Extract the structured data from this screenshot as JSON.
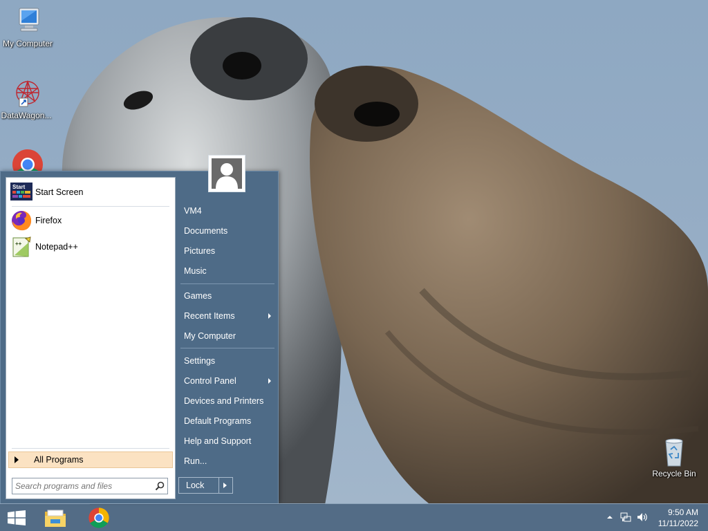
{
  "desktop": {
    "icons": [
      {
        "label": "My Computer",
        "icon": "computer-icon"
      },
      {
        "label": "DataWagon...",
        "icon": "datawagon-icon"
      },
      {
        "label": "",
        "icon": "chrome-icon"
      },
      {
        "label": "Recycle Bin",
        "icon": "recycle-bin-icon"
      }
    ]
  },
  "start_menu": {
    "pinned": [
      {
        "label": "Start Screen",
        "icon": "start-screen-icon"
      },
      {
        "label": "Firefox",
        "icon": "firefox-icon"
      },
      {
        "label": "Notepad++",
        "icon": "notepadpp-icon"
      }
    ],
    "all_programs": "All Programs",
    "search_placeholder": "Search programs and files",
    "user_tile_icon": "user-avatar-icon",
    "right_items": [
      {
        "label": "VM4"
      },
      {
        "label": "Documents"
      },
      {
        "label": "Pictures"
      },
      {
        "label": "Music"
      },
      {
        "label": "Games"
      },
      {
        "label": "Recent Items",
        "submenu": true
      },
      {
        "label": "My Computer"
      },
      {
        "label": "Settings"
      },
      {
        "label": "Control Panel",
        "submenu": true
      },
      {
        "label": "Devices and Printers"
      },
      {
        "label": "Default Programs"
      },
      {
        "label": "Help and Support"
      },
      {
        "label": "Run..."
      }
    ],
    "lock_label": "Lock"
  },
  "taskbar": {
    "items": [
      {
        "icon": "windows-start-icon"
      },
      {
        "icon": "file-explorer-icon"
      },
      {
        "icon": "chrome-icon"
      }
    ],
    "tray": [
      {
        "icon": "show-hidden-icons-icon"
      },
      {
        "icon": "network-icon"
      },
      {
        "icon": "volume-icon"
      }
    ],
    "time": "9:50 AM",
    "date": "11/11/2022"
  },
  "colors": {
    "menu_background": "#4e6b87",
    "all_programs_highlight": "#fbe2c2",
    "taskbar": "#48627c"
  }
}
